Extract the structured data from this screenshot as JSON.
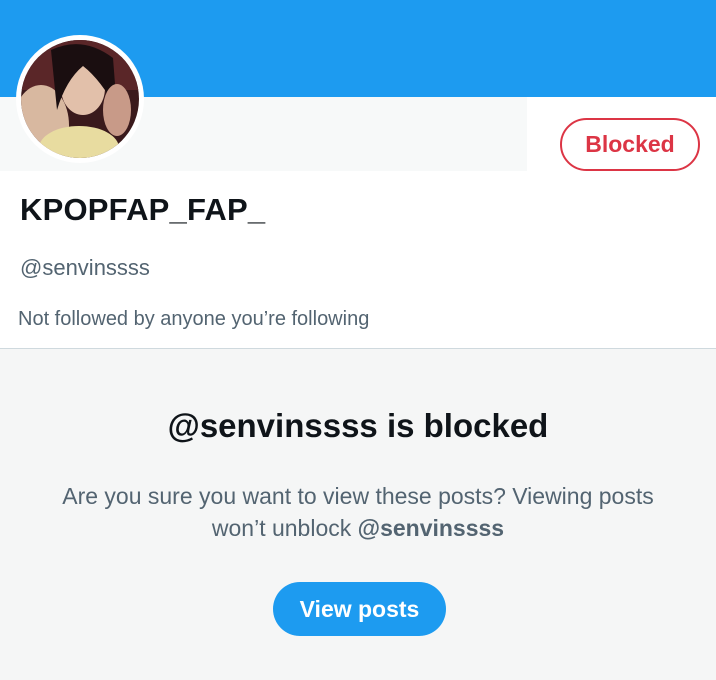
{
  "profile": {
    "display_name": "KPOPFAP_FAP_",
    "handle": "@senvinssss",
    "follow_note": "Not followed by anyone you’re following",
    "blocked_button_label": "Blocked",
    "avatar": "profile-photo"
  },
  "blocked_notice": {
    "title": "@senvinssss is blocked",
    "description_prefix": "Are you sure you want to view these posts? Viewing posts won’t unblock ",
    "description_handle": "@senvinssss",
    "view_button_label": "View posts"
  },
  "colors": {
    "banner": "#1d9bf0",
    "blocked_accent": "#dc3545",
    "primary_button": "#1d9bf0",
    "secondary_text": "#536471"
  }
}
